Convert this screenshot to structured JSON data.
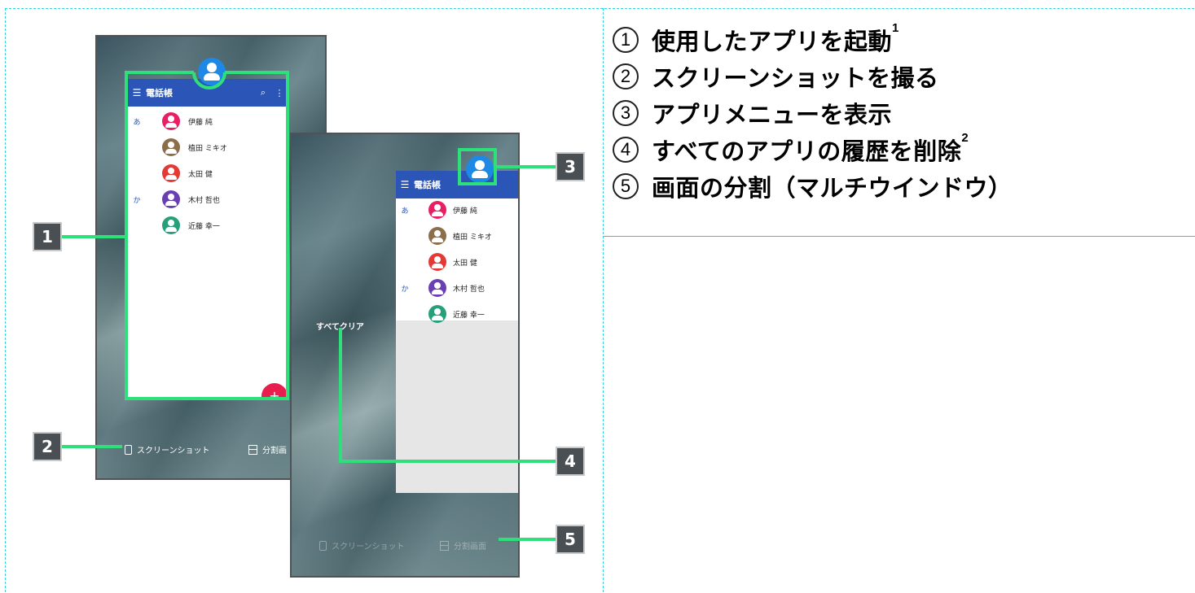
{
  "phone1": {
    "app_title": "電話帳",
    "search_icon": "search-icon",
    "contacts": [
      {
        "section": "あ",
        "name": "伊藤 純",
        "color": "#e91e63"
      },
      {
        "section": "",
        "name": "植田 ミキオ",
        "color": "#8d6e4a"
      },
      {
        "section": "",
        "name": "太田 健",
        "color": "#e53935"
      },
      {
        "section": "か",
        "name": "木村 哲也",
        "color": "#6a3fb3"
      },
      {
        "section": "",
        "name": "近藤 幸一",
        "color": "#26a07a"
      }
    ],
    "fab_label": "+",
    "screenshot_label": "スクリーンショット",
    "split_label": "分割画"
  },
  "phone2": {
    "app_title": "電話帳",
    "clear_all_label": "すべてクリア",
    "screenshot_label": "スクリーンショット",
    "split_label": "分割画面"
  },
  "callouts": [
    "1",
    "2",
    "3",
    "4",
    "5"
  ],
  "legend": [
    {
      "num": "1",
      "text": "使用したアプリを起動",
      "sup": "1"
    },
    {
      "num": "2",
      "text": "スクリーンショットを撮る",
      "sup": ""
    },
    {
      "num": "3",
      "text": "アプリメニューを表示",
      "sup": ""
    },
    {
      "num": "4",
      "text": "すべてのアプリの履歴を削除",
      "sup": "2"
    },
    {
      "num": "5",
      "text": "画面の分割（マルチウインドウ）",
      "sup": ""
    }
  ],
  "colors": {
    "highlight": "#2ee07a",
    "callout_bg": "#4a4f53",
    "appbar": "#2b56b8"
  }
}
